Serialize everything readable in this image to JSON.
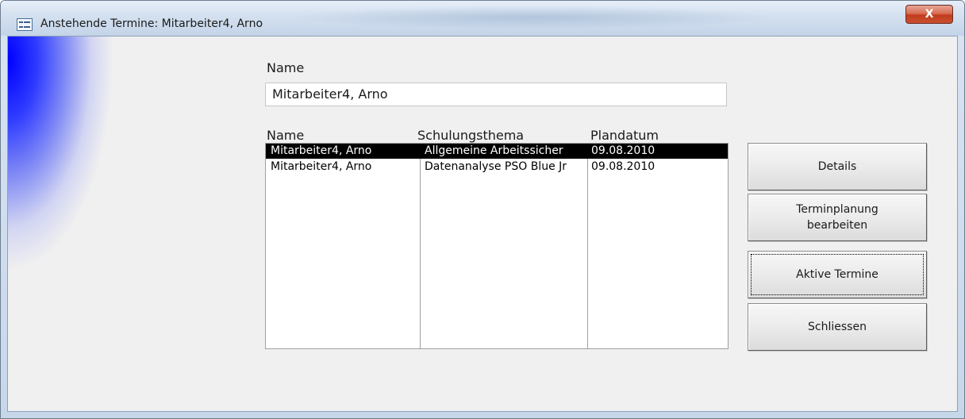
{
  "window": {
    "title": "Anstehende Termine: Mitarbeiter4, Arno",
    "close_label": "X"
  },
  "form": {
    "name_label": "Name",
    "name_value": "Mitarbeiter4, Arno"
  },
  "list": {
    "headers": [
      "Name",
      "Schulungsthema",
      "Plandatum"
    ],
    "rows": [
      {
        "name": "Mitarbeiter4, Arno",
        "topic": "Allgemeine Arbeitssicher",
        "date": "09.08.2010",
        "selected": true
      },
      {
        "name": "Mitarbeiter4, Arno",
        "topic": "Datenanalyse PSO Blue Jr",
        "date": "09.08.2010",
        "selected": false
      }
    ]
  },
  "buttons": {
    "details": "Details",
    "terminplanung_line1": "Terminplanung",
    "terminplanung_line2": "bearbeiten",
    "aktive_termine": "Aktive Termine",
    "schliessen": "Schliessen"
  },
  "colors": {
    "selection": "#000000",
    "decoration": "#0000ff",
    "close_button": "#c9502f"
  },
  "icons": {
    "window_icon": "form-window-icon",
    "close": "close-icon"
  }
}
